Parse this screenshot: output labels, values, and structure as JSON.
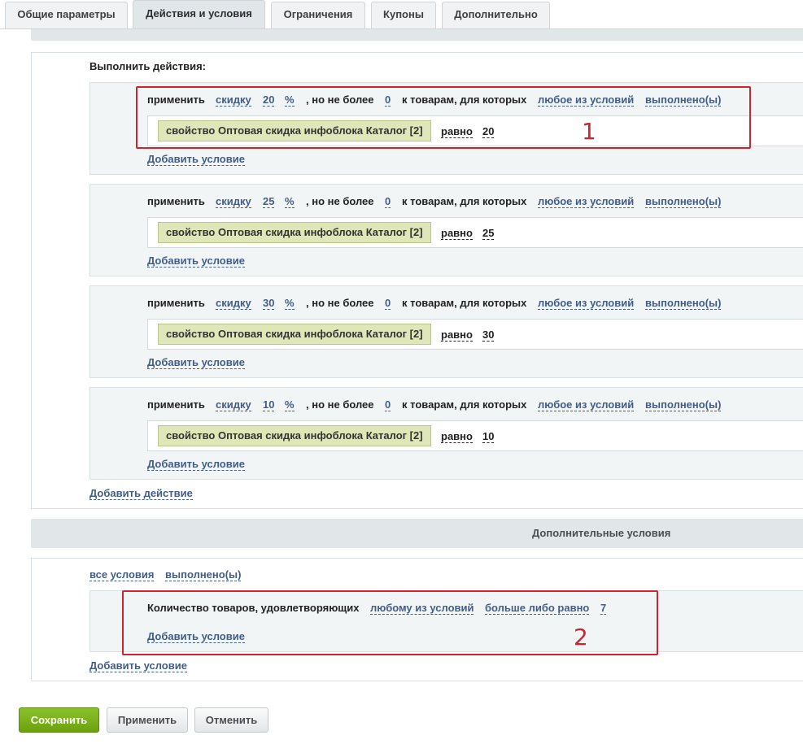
{
  "tabs": [
    "Общие параметры",
    "Действия и условия",
    "Ограничения",
    "Купоны",
    "Дополнительно"
  ],
  "actions": {
    "title": "Выполнить действия:",
    "items": [
      {
        "apply": "применить",
        "discount": "скидку",
        "value": "20",
        "unit": "%",
        "not_more": ", но не более",
        "max": "0",
        "for_goods": "к товарам, для которых",
        "any": "любое из условий",
        "done": "выполнено(ы)",
        "property": "свойство Оптовая скидка инфоблока Каталог [2]",
        "equals": "равно",
        "prop_value": "20",
        "add_condition": "Добавить условие"
      },
      {
        "apply": "применить",
        "discount": "скидку",
        "value": "25",
        "unit": "%",
        "not_more": ", но не более",
        "max": "0",
        "for_goods": "к товарам, для которых",
        "any": "любое из условий",
        "done": "выполнено(ы)",
        "property": "свойство Оптовая скидка инфоблока Каталог [2]",
        "equals": "равно",
        "prop_value": "25",
        "add_condition": "Добавить условие"
      },
      {
        "apply": "применить",
        "discount": "скидку",
        "value": "30",
        "unit": "%",
        "not_more": ", но не более",
        "max": "0",
        "for_goods": "к товарам, для которых",
        "any": "любое из условий",
        "done": "выполнено(ы)",
        "property": "свойство Оптовая скидка инфоблока Каталог [2]",
        "equals": "равно",
        "prop_value": "30",
        "add_condition": "Добавить условие"
      },
      {
        "apply": "применить",
        "discount": "скидку",
        "value": "10",
        "unit": "%",
        "not_more": ", но не более",
        "max": "0",
        "for_goods": "к товарам, для которых",
        "any": "любое из условий",
        "done": "выполнено(ы)",
        "property": "свойство Оптовая скидка инфоблока Каталог [2]",
        "equals": "равно",
        "prop_value": "10",
        "add_condition": "Добавить условие"
      }
    ],
    "add_action": "Добавить действие"
  },
  "extra": {
    "title": "Дополнительные условия",
    "all": "все условия",
    "done": "выполнено(ы)",
    "qty_label": "Количество товаров, удовлетворяющих",
    "any": "любому из условий",
    "cmp": "больше либо равно",
    "qty": "7",
    "add_condition_inner": "Добавить условие",
    "add_condition": "Добавить условие"
  },
  "annotations": [
    "1",
    "2"
  ],
  "buttons": {
    "save": "Сохранить",
    "apply": "Применить",
    "cancel": "Отменить"
  }
}
